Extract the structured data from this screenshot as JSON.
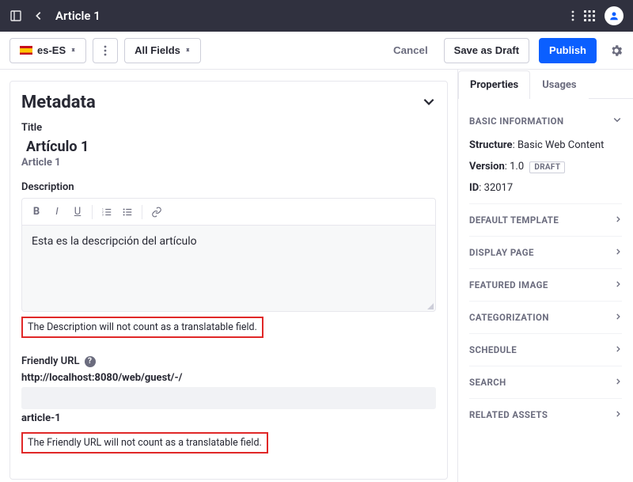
{
  "topbar": {
    "title": "Article 1"
  },
  "toolbar": {
    "locale": "es-ES",
    "fields_filter": "All Fields",
    "cancel": "Cancel",
    "save_draft": "Save as Draft",
    "publish": "Publish"
  },
  "metadata": {
    "heading": "Metadata",
    "title_label": "Title",
    "title_main": "Artículo 1",
    "title_sub": "Article 1",
    "description_label": "Description",
    "description_value": "Esta es la descripción del artículo",
    "description_note": "The Description will not count as a translatable field.",
    "friendly_url_label": "Friendly URL",
    "friendly_url_prefix": "http://localhost:8080/web/guest/-/",
    "friendly_url_slug": "article-1",
    "friendly_url_note": "The Friendly URL will not count as a translatable field."
  },
  "side": {
    "tabs": {
      "properties": "Properties",
      "usages": "Usages"
    },
    "basic_heading": "BASIC INFORMATION",
    "structure_label": "Structure",
    "structure_value": "Basic Web Content",
    "version_label": "Version",
    "version_value": "1.0",
    "status_badge": "DRAFT",
    "id_label": "ID",
    "id_value": "32017",
    "sections": [
      "DEFAULT TEMPLATE",
      "DISPLAY PAGE",
      "FEATURED IMAGE",
      "CATEGORIZATION",
      "SCHEDULE",
      "SEARCH",
      "RELATED ASSETS"
    ]
  }
}
